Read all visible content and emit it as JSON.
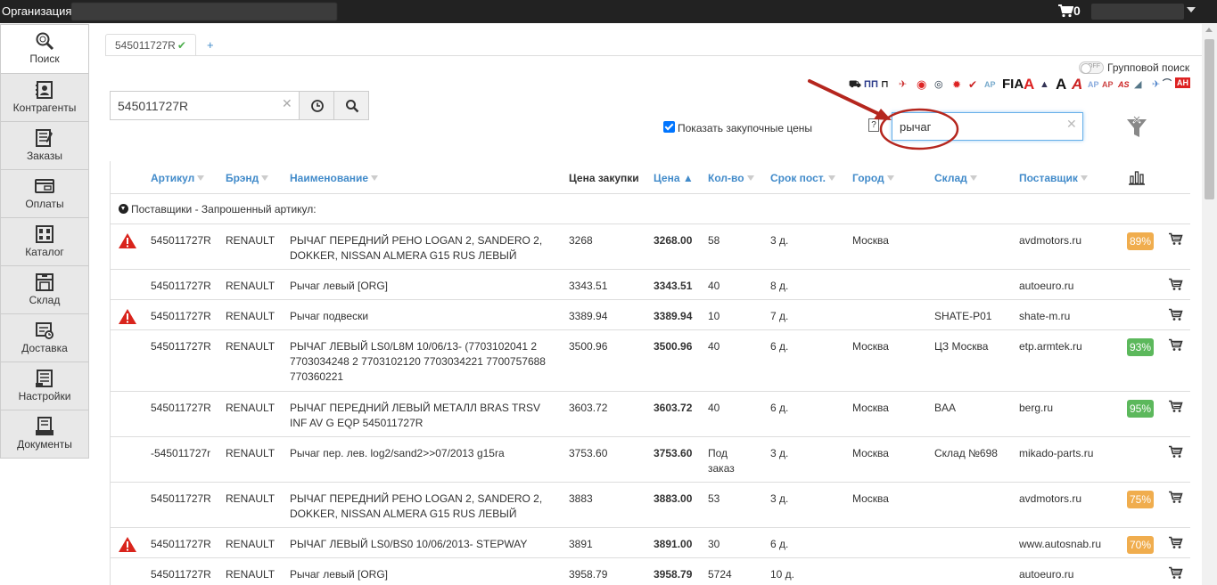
{
  "topbar": {
    "org_label": "Организация:",
    "cart_count": "0"
  },
  "sidebar": {
    "items": [
      {
        "label": "Поиск",
        "icon": "search-icon"
      },
      {
        "label": "Контрагенты",
        "icon": "contacts-icon"
      },
      {
        "label": "Заказы",
        "icon": "orders-icon"
      },
      {
        "label": "Оплаты",
        "icon": "payments-icon"
      },
      {
        "label": "Каталог",
        "icon": "catalog-icon"
      },
      {
        "label": "Склад",
        "icon": "warehouse-icon"
      },
      {
        "label": "Доставка",
        "icon": "delivery-icon"
      },
      {
        "label": "Настройки",
        "icon": "settings-icon"
      },
      {
        "label": "Документы",
        "icon": "documents-icon"
      }
    ]
  },
  "tabs": {
    "active_label": "545011727R",
    "add_label": "+"
  },
  "group_search": {
    "label": "Групповой поиск",
    "toggle_text": "OFF"
  },
  "search": {
    "value": "545011727R",
    "clear": "✕"
  },
  "purchase_prices": {
    "label": "Показать закупочные цены",
    "help": "?"
  },
  "filter": {
    "value": "рычаг",
    "clear": "✕"
  },
  "brand_logos": [
    "A",
    "A",
    "FIA"
  ],
  "colors": {
    "link": "#428bca",
    "warn": "#d9241c",
    "pct_orange": "#f0ad4e",
    "pct_green": "#5cb85c",
    "annotation": "#b5261e"
  },
  "table": {
    "headers": {
      "article": "Артикул",
      "brand": "Брэнд",
      "name": "Наименование",
      "purchase_price": "Цена закупки",
      "price": "Цена ▲",
      "qty": "Кол-во",
      "term": "Срок пост.",
      "city": "Город",
      "warehouse": "Склад",
      "supplier": "Поставщик"
    },
    "group_label": "Поставщики - Запрошенный артикул:",
    "rows": [
      {
        "warn": true,
        "article": "545011727R",
        "brand": "RENAULT",
        "name": "РЫЧАГ ПЕРЕДНИЙ РЕНО LOGAN 2, SANDERO 2, DOKKER, NISSAN ALMERA G15 RUS ЛЕВЫЙ",
        "purchase": "3268",
        "price": "3268.00",
        "qty": "58",
        "term": "3 д.",
        "city": "Москва",
        "warehouse": "",
        "supplier": "avdmotors.ru",
        "pct": "89%",
        "pct_color": "orange"
      },
      {
        "warn": false,
        "article": "545011727R",
        "brand": "RENAULT",
        "name": "Рычаг левый [ORG]",
        "purchase": "3343.51",
        "price": "3343.51",
        "qty": "40",
        "term": "8 д.",
        "city": "",
        "warehouse": "",
        "supplier": "autoeuro.ru",
        "pct": "",
        "pct_color": ""
      },
      {
        "warn": true,
        "article": "545011727R",
        "brand": "RENAULT",
        "name": "Рычаг подвески",
        "purchase": "3389.94",
        "price": "3389.94",
        "qty": "10",
        "term": "7 д.",
        "city": "",
        "warehouse": "SHATE-P01",
        "supplier": "shate-m.ru",
        "pct": "",
        "pct_color": ""
      },
      {
        "warn": false,
        "article": "545011727R",
        "brand": "RENAULT",
        "name": "РЫЧАГ ЛЕВЫЙ LS0/L8M 10/06/13- (7703102041 2 7703034248 2 7703102120 7703034221 7700757688 770360221",
        "purchase": "3500.96",
        "price": "3500.96",
        "qty": "40",
        "term": "6 д.",
        "city": "Москва",
        "warehouse": "ЦЗ Москва",
        "supplier": "etp.armtek.ru",
        "pct": "93%",
        "pct_color": "green"
      },
      {
        "warn": false,
        "article": "545011727R",
        "brand": "RENAULT",
        "name": "РЫЧАГ ПЕРЕДНИЙ ЛЕВЫЙ МЕТАЛЛ BRAS TRSV INF AV G EQP 545011727R",
        "purchase": "3603.72",
        "price": "3603.72",
        "qty": "40",
        "term": "6 д.",
        "city": "Москва",
        "warehouse": "BAA",
        "supplier": "berg.ru",
        "pct": "95%",
        "pct_color": "green"
      },
      {
        "warn": false,
        "article": "-545011727r",
        "brand": "RENAULT",
        "name": "Рычаг пер. лев. log2/sand2>>07/2013 g15ra",
        "purchase": "3753.60",
        "price": "3753.60",
        "qty": "Под заказ",
        "term": "3 д.",
        "city": "Москва",
        "warehouse": "Склад №698",
        "supplier": "mikado-parts.ru",
        "pct": "",
        "pct_color": ""
      },
      {
        "warn": false,
        "article": "545011727R",
        "brand": "RENAULT",
        "name": "РЫЧАГ ПЕРЕДНИЙ РЕНО LOGAN 2, SANDERO 2, DOKKER, NISSAN ALMERA G15 RUS ЛЕВЫЙ",
        "purchase": "3883",
        "price": "3883.00",
        "qty": "53",
        "term": "3 д.",
        "city": "Москва",
        "warehouse": "",
        "supplier": "avdmotors.ru",
        "pct": "75%",
        "pct_color": "orange"
      },
      {
        "warn": true,
        "article": "545011727R",
        "brand": "RENAULT",
        "name": "РЫЧАГ ЛЕВЫЙ LS0/BS0 10/06/2013- STEPWAY",
        "purchase": "3891",
        "price": "3891.00",
        "qty": "30",
        "term": "6 д.",
        "city": "",
        "warehouse": "",
        "supplier": "www.autosnab.ru",
        "pct": "70%",
        "pct_color": "orange"
      },
      {
        "warn": false,
        "article": "545011727R",
        "brand": "RENAULT",
        "name": "Рычаг левый [ORG]",
        "purchase": "3958.79",
        "price": "3958.79",
        "qty": "5724",
        "term": "10 д.",
        "city": "",
        "warehouse": "",
        "supplier": "autoeuro.ru",
        "pct": "",
        "pct_color": ""
      }
    ]
  }
}
